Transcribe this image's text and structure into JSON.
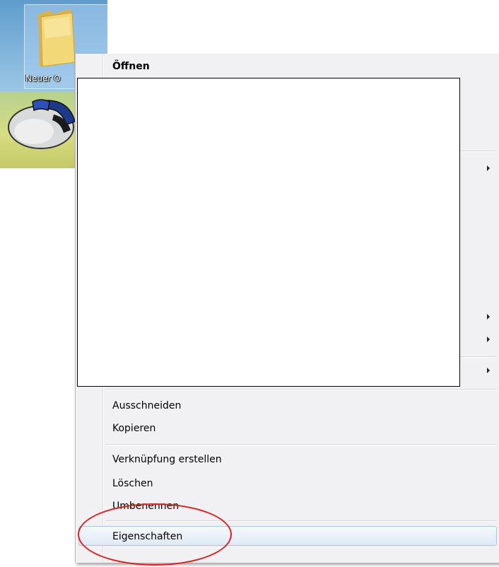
{
  "desktop": {
    "folder_label": "Neuer O",
    "folder_icon": "folder-icon",
    "mouse_icon": "mouse-icon"
  },
  "context_menu": {
    "items": [
      {
        "label": "Öffnen",
        "bold": true
      },
      {
        "label": "Ausschneiden"
      },
      {
        "label": "Kopieren"
      },
      {
        "label": "Verknüpfung erstellen"
      },
      {
        "label": "Löschen"
      },
      {
        "label": "Umbenennen"
      },
      {
        "label": "Eigenschaften",
        "highlighted": true
      }
    ],
    "submenu_arrow_icon": "chevron-right-icon"
  },
  "colors": {
    "menu_background": "#f1f0f3",
    "highlight_border": "#a8c6e8",
    "annotation": "#e02020"
  }
}
